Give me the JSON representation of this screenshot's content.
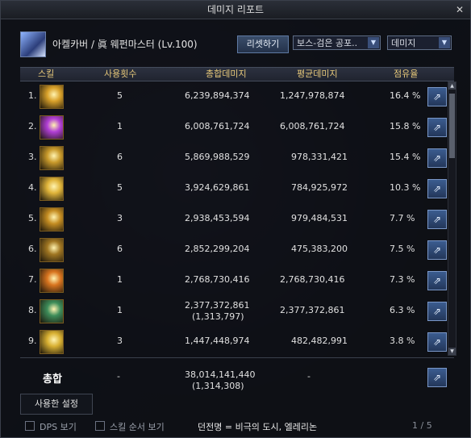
{
  "window": {
    "title": "데미지 리포트"
  },
  "header": {
    "character": "아켈카버 / 眞 웨펀마스터 (Lv.100)",
    "reset_label": "리셋하기",
    "boss_select": "보스-검은 공포..",
    "metric_select": "데미지"
  },
  "columns": {
    "skill": "스킬",
    "uses": "사용횟수",
    "total": "총합데미지",
    "avg": "평균데미지",
    "share": "점유율"
  },
  "rows": [
    {
      "rank": "1.",
      "uses": "5",
      "total": "6,239,894,374",
      "total_sub": "",
      "avg": "1,247,978,874",
      "share": "16.4 %",
      "icon_color": "#d9a12a"
    },
    {
      "rank": "2.",
      "uses": "1",
      "total": "6,008,761,724",
      "total_sub": "",
      "avg": "6,008,761,724",
      "share": "15.8 %",
      "icon_color": "#b23fd6"
    },
    {
      "rank": "3.",
      "uses": "6",
      "total": "5,869,988,529",
      "total_sub": "",
      "avg": "978,331,421",
      "share": "15.4 %",
      "icon_color": "#c99a2b"
    },
    {
      "rank": "4.",
      "uses": "5",
      "total": "3,924,629,861",
      "total_sub": "",
      "avg": "784,925,972",
      "share": "10.3 %",
      "icon_color": "#e0b43a"
    },
    {
      "rank": "5.",
      "uses": "3",
      "total": "2,938,453,594",
      "total_sub": "",
      "avg": "979,484,531",
      "share": "7.7 %",
      "icon_color": "#c58d22"
    },
    {
      "rank": "6.",
      "uses": "6",
      "total": "2,852,299,204",
      "total_sub": "",
      "avg": "475,383,200",
      "share": "7.5 %",
      "icon_color": "#a07622"
    },
    {
      "rank": "7.",
      "uses": "1",
      "total": "2,768,730,416",
      "total_sub": "",
      "avg": "2,768,730,416",
      "share": "7.3 %",
      "icon_color": "#d9751f"
    },
    {
      "rank": "8.",
      "uses": "1",
      "total": "2,377,372,861",
      "total_sub": "(1,313,797)",
      "avg": "2,377,372,861",
      "share": "6.3 %",
      "icon_color": "#3e8d5a"
    },
    {
      "rank": "9.",
      "uses": "3",
      "total": "1,447,448,974",
      "total_sub": "",
      "avg": "482,482,991",
      "share": "3.8 %",
      "icon_color": "#d8b032"
    }
  ],
  "total": {
    "label": "총합",
    "uses": "-",
    "total": "38,014,141,440",
    "total_sub": "(1,314,308)",
    "avg": "-"
  },
  "used_setting_label": "사용한 설정",
  "footer": {
    "dps_label": "DPS 보기",
    "skill_order_label": "스킬 순서 보기",
    "dungeon": "던전명 = 비극의 도시, 엘레리논",
    "pager": "1 / 5"
  }
}
